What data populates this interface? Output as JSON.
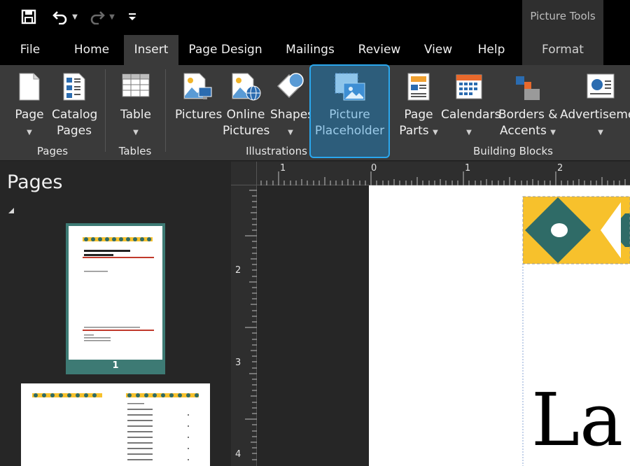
{
  "qat": {
    "save_icon": "save-icon",
    "undo_icon": "undo-icon",
    "redo_icon": "redo-icon",
    "customize_icon": "customize-qat-icon"
  },
  "contextual": {
    "label": "Picture Tools"
  },
  "tabs": [
    {
      "label": "File"
    },
    {
      "label": "Home"
    },
    {
      "label": "Insert"
    },
    {
      "label": "Page Design"
    },
    {
      "label": "Mailings"
    },
    {
      "label": "Review"
    },
    {
      "label": "View"
    },
    {
      "label": "Help"
    },
    {
      "label": "Format"
    }
  ],
  "ribbon": {
    "page": {
      "line1": "Page"
    },
    "catalog": {
      "line1": "Catalog",
      "line2": "Pages"
    },
    "table": {
      "line1": "Table"
    },
    "pictures": {
      "line1": "Pictures"
    },
    "online_pictures": {
      "line1": "Online",
      "line2": "Pictures"
    },
    "shapes": {
      "line1": "Shapes"
    },
    "picture_placeholder": {
      "line1": "Picture",
      "line2": "Placeholder"
    },
    "page_parts": {
      "line1": "Page",
      "line2": "Parts"
    },
    "calendars": {
      "line1": "Calendars"
    },
    "borders": {
      "line1": "Borders &",
      "line2": "Accents"
    },
    "advertisements": {
      "line1": "Advertisements"
    },
    "groups": {
      "pages": "Pages",
      "tables": "Tables",
      "illustrations": "Illustrations",
      "building_blocks": "Building Blocks"
    }
  },
  "pages_pane": {
    "title": "Pages",
    "page1_number": "1"
  },
  "ruler": {
    "h_labels": [
      "1",
      "0",
      "1",
      "2"
    ],
    "v_labels": [
      "2",
      "3",
      "4"
    ]
  },
  "document": {
    "big_text": "La"
  },
  "colors": {
    "accent_teal": "#2f6b67",
    "accent_yellow": "#f7c12c",
    "highlight_blue": "#2aa7ee",
    "thumb_red": "#c0392b"
  }
}
